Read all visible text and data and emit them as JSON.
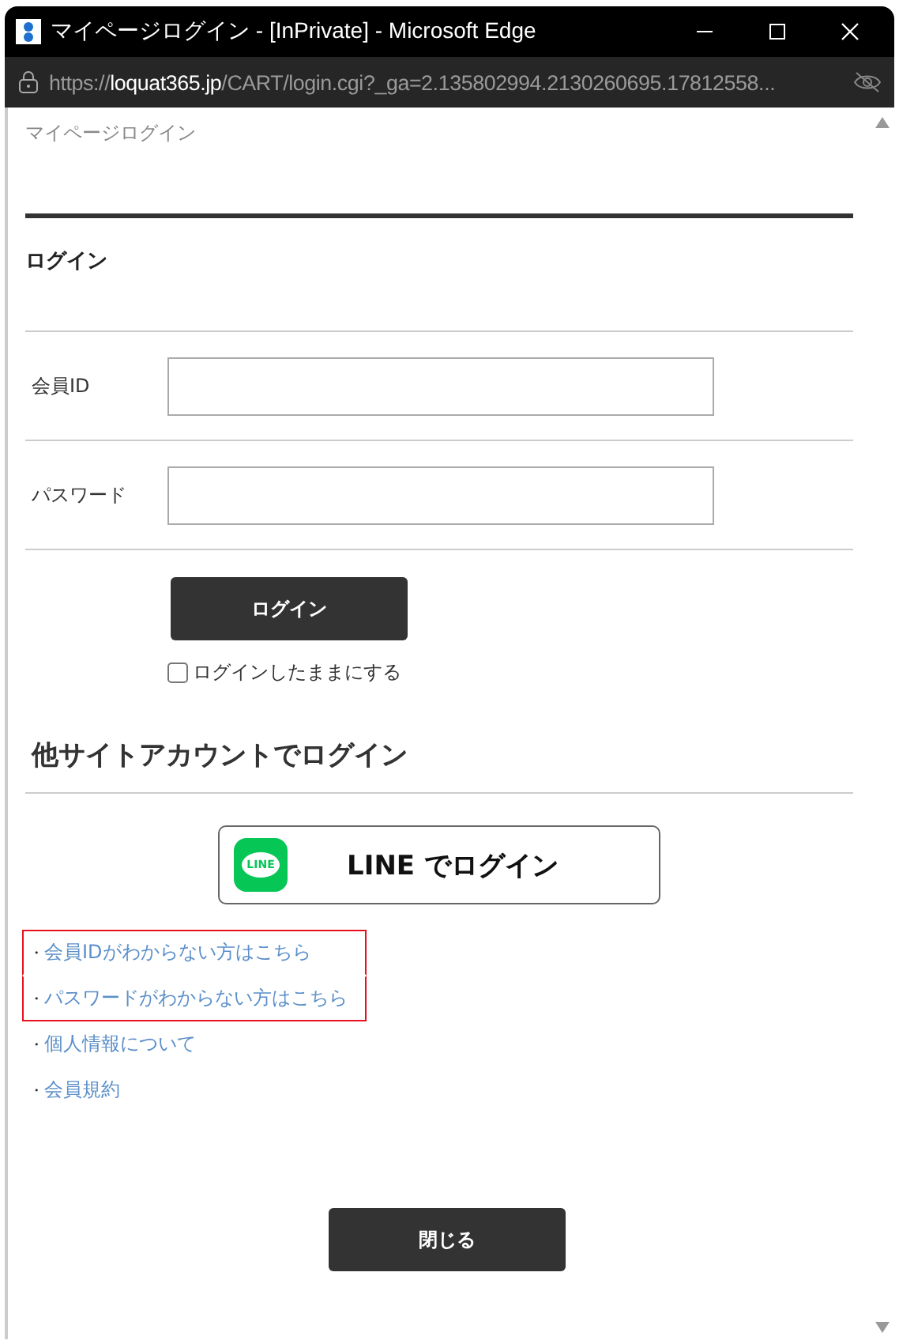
{
  "window": {
    "title": "マイページログイン - [InPrivate] - Microsoft Edge"
  },
  "address_bar": {
    "scheme": "https://",
    "domain": "loquat365.jp",
    "path": "/CART/login.cgi?_ga=2.135802994.2130260695.17812558..."
  },
  "breadcrumb": "マイページログイン",
  "section_title": "ログイン",
  "fields": [
    {
      "label": "会員ID"
    },
    {
      "label": "パスワード"
    }
  ],
  "login_button": "ログイン",
  "remember": {
    "label": "ログインしたままにする",
    "checked": false
  },
  "other_title": "他サイトアカウントでログイン",
  "line_button": {
    "label": "LINE でログイン",
    "icon_text": "LINE"
  },
  "links": [
    {
      "bullet": "・",
      "label": "会員IDがわからない方はこちら",
      "highlighted": true
    },
    {
      "bullet": "・",
      "label": "パスワードがわからない方はこちら",
      "highlighted": true
    },
    {
      "bullet": "・",
      "label": "個人情報について",
      "highlighted": false
    },
    {
      "bullet": "・",
      "label": "会員規約",
      "highlighted": false
    }
  ],
  "close_button": "閉じる"
}
